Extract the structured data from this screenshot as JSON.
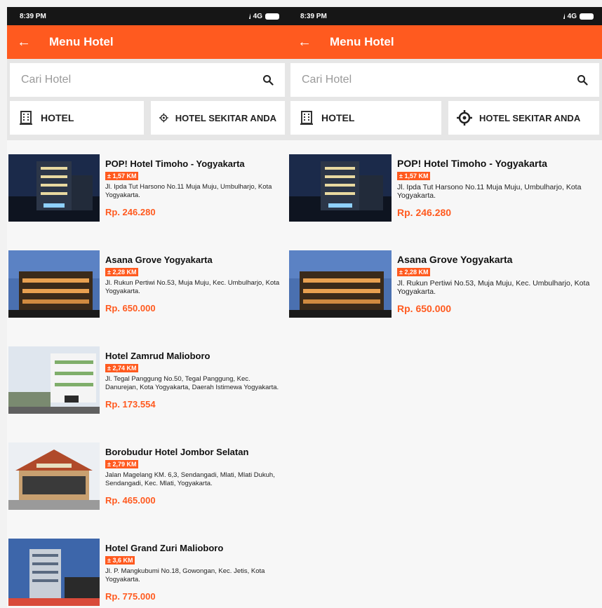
{
  "status": {
    "time": "8:39 PM",
    "network": "4G"
  },
  "appbar": {
    "title": "Menu Hotel"
  },
  "search": {
    "placeholder": "Cari Hotel"
  },
  "tabs": {
    "hotel": "HOTEL",
    "near": "HOTEL SEKITAR ANDA"
  },
  "colors": {
    "accent": "#ff5a1f",
    "status_bar": "#161616"
  },
  "icons": {
    "back": "arrow-left-icon",
    "search": "search-icon",
    "hotel": "building-icon",
    "near": "crosshair-icon"
  },
  "hotels": [
    {
      "name": "POP! Hotel Timoho - Yogyakarta",
      "distance": "± 1,57 KM",
      "address": "Jl. Ipda Tut Harsono No.11 Muja Muju, Umbulharjo, Kota Yogyakarta.",
      "price": "Rp. 246.280"
    },
    {
      "name": "Asana Grove Yogyakarta",
      "distance": "± 2,28 KM",
      "address": "Jl. Rukun Pertiwi No.53, Muja Muju, Kec. Umbulharjo, Kota Yogyakarta.",
      "price": "Rp. 650.000"
    },
    {
      "name": "Hotel Zamrud Malioboro",
      "distance": "± 2,74 KM",
      "address": "Jl. Tegal Panggung No.50, Tegal Panggung, Kec. Danurejan, Kota Yogyakarta, Daerah Istimewa Yogyakarta.",
      "price": "Rp. 173.554"
    },
    {
      "name": "Borobudur Hotel Jombor Selatan",
      "distance": "± 2,79 KM",
      "address": "Jalan Magelang KM. 6,3, Sendangadi, Mlati, Mlati Dukuh, Sendangadi, Kec. Mlati, Yogyakarta.",
      "price": "Rp. 465.000"
    },
    {
      "name": "Hotel Grand Zuri Malioboro",
      "distance": "± 3,6 KM",
      "address": "Jl. P. Mangkubumi No.18, Gowongan, Kec. Jetis, Kota Yogyakarta.",
      "price": "Rp. 775.000"
    }
  ],
  "hotels_right": [
    {
      "name": "POP! Hotel Timoho - Yogyakarta",
      "distance": "± 1,57 KM",
      "address": "Jl. Ipda Tut Harsono No.11 Muja Muju, Umbulharjo, Kota Yogyakarta.",
      "price": "Rp. 246.280"
    },
    {
      "name": "Asana Grove Yogyakarta",
      "distance": "± 2,28 KM",
      "address": "Jl. Rukun Pertiwi No.53, Muja Muju, Kec. Umbulharjo, Kota Yogyakarta.",
      "price": "Rp. 650.000"
    }
  ]
}
